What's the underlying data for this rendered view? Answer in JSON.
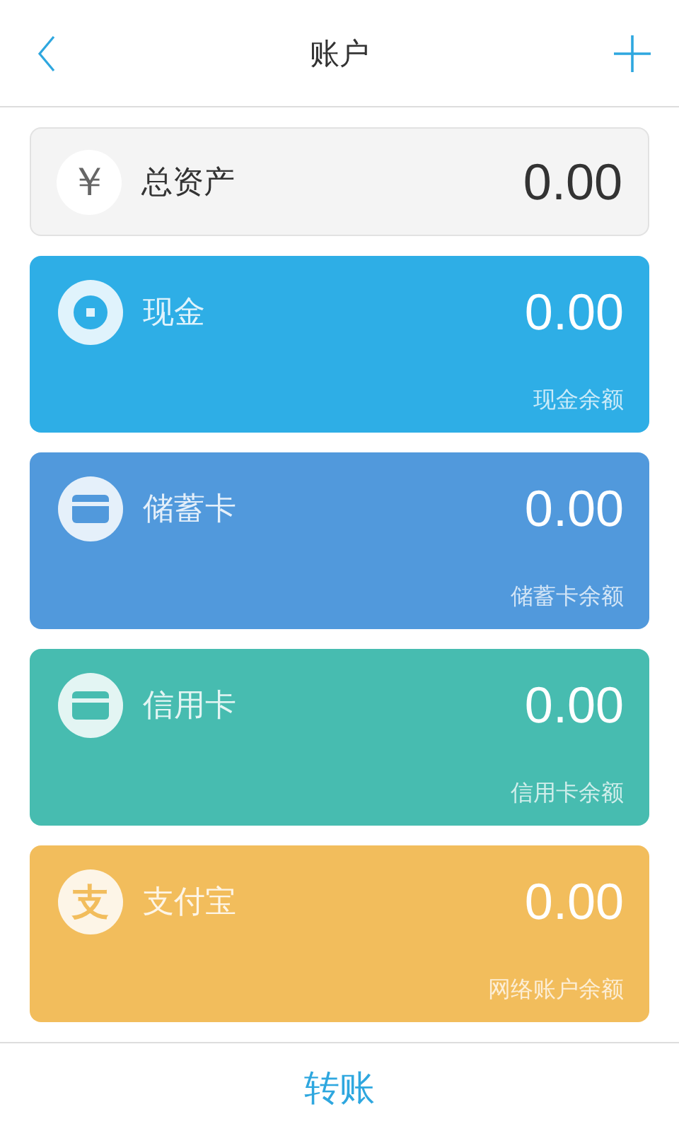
{
  "header": {
    "title": "账户"
  },
  "total": {
    "symbol": "￥",
    "label": "总资产",
    "amount": "0.00"
  },
  "accounts": [
    {
      "kind": "coin",
      "name": "现金",
      "amount": "0.00",
      "caption": "现金余额",
      "color": "#2eaee6"
    },
    {
      "kind": "card",
      "name": "储蓄卡",
      "amount": "0.00",
      "caption": "储蓄卡余额",
      "color": "#5199dc"
    },
    {
      "kind": "card",
      "name": "信用卡",
      "amount": "0.00",
      "caption": "信用卡余额",
      "color": "#47bcb0"
    },
    {
      "kind": "glyph",
      "glyph": "支",
      "name": "支付宝",
      "amount": "0.00",
      "caption": "网络账户余额",
      "color": "#f2bd5c"
    }
  ],
  "footer": {
    "button": "转账"
  }
}
